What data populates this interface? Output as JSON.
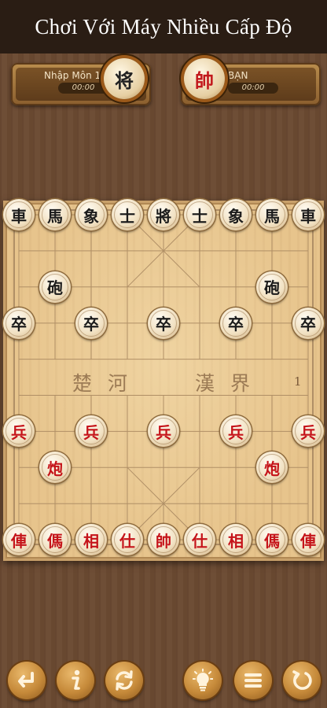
{
  "header": {
    "title": "Chơi Với Máy Nhiều Cấp Độ"
  },
  "players": {
    "ai": {
      "name": "Nhập Môn 1",
      "timer": "00:00",
      "avatar_char": "将"
    },
    "you": {
      "name": "BẠN",
      "timer": "00:00",
      "avatar_char": "帥"
    }
  },
  "board": {
    "river_left": "楚河",
    "river_right": "漢界",
    "move_number": "1",
    "pieces": [
      {
        "char": "車",
        "side": "black",
        "col": 0,
        "row": 0
      },
      {
        "char": "馬",
        "side": "black",
        "col": 1,
        "row": 0
      },
      {
        "char": "象",
        "side": "black",
        "col": 2,
        "row": 0
      },
      {
        "char": "士",
        "side": "black",
        "col": 3,
        "row": 0
      },
      {
        "char": "將",
        "side": "black",
        "col": 4,
        "row": 0
      },
      {
        "char": "士",
        "side": "black",
        "col": 5,
        "row": 0
      },
      {
        "char": "象",
        "side": "black",
        "col": 6,
        "row": 0
      },
      {
        "char": "馬",
        "side": "black",
        "col": 7,
        "row": 0
      },
      {
        "char": "車",
        "side": "black",
        "col": 8,
        "row": 0
      },
      {
        "char": "砲",
        "side": "black",
        "col": 1,
        "row": 2
      },
      {
        "char": "砲",
        "side": "black",
        "col": 7,
        "row": 2
      },
      {
        "char": "卒",
        "side": "black",
        "col": 0,
        "row": 3
      },
      {
        "char": "卒",
        "side": "black",
        "col": 2,
        "row": 3
      },
      {
        "char": "卒",
        "side": "black",
        "col": 4,
        "row": 3
      },
      {
        "char": "卒",
        "side": "black",
        "col": 6,
        "row": 3
      },
      {
        "char": "卒",
        "side": "black",
        "col": 8,
        "row": 3
      },
      {
        "char": "兵",
        "side": "red",
        "col": 0,
        "row": 6
      },
      {
        "char": "兵",
        "side": "red",
        "col": 2,
        "row": 6
      },
      {
        "char": "兵",
        "side": "red",
        "col": 4,
        "row": 6
      },
      {
        "char": "兵",
        "side": "red",
        "col": 6,
        "row": 6
      },
      {
        "char": "兵",
        "side": "red",
        "col": 8,
        "row": 6
      },
      {
        "char": "炮",
        "side": "red",
        "col": 1,
        "row": 7
      },
      {
        "char": "炮",
        "side": "red",
        "col": 7,
        "row": 7
      },
      {
        "char": "俥",
        "side": "red",
        "col": 0,
        "row": 9
      },
      {
        "char": "傌",
        "side": "red",
        "col": 1,
        "row": 9
      },
      {
        "char": "相",
        "side": "red",
        "col": 2,
        "row": 9
      },
      {
        "char": "仕",
        "side": "red",
        "col": 3,
        "row": 9
      },
      {
        "char": "帥",
        "side": "red",
        "col": 4,
        "row": 9
      },
      {
        "char": "仕",
        "side": "red",
        "col": 5,
        "row": 9
      },
      {
        "char": "相",
        "side": "red",
        "col": 6,
        "row": 9
      },
      {
        "char": "傌",
        "side": "red",
        "col": 7,
        "row": 9
      },
      {
        "char": "俥",
        "side": "red",
        "col": 8,
        "row": 9
      }
    ]
  },
  "controls": [
    {
      "name": "undo-button",
      "icon": "undo-arrow-icon"
    },
    {
      "name": "info-button",
      "icon": "info-icon"
    },
    {
      "name": "swap-button",
      "icon": "swap-arrows-icon"
    },
    {
      "name": "hint-button",
      "icon": "lightbulb-icon"
    },
    {
      "name": "menu-button",
      "icon": "menu-icon"
    },
    {
      "name": "restart-button",
      "icon": "restart-icon"
    }
  ],
  "colors": {
    "red_piece": "#c5141a",
    "black_piece": "#1c1c1c",
    "board": "#e7c48c",
    "header_bg": "#2a1d14"
  }
}
